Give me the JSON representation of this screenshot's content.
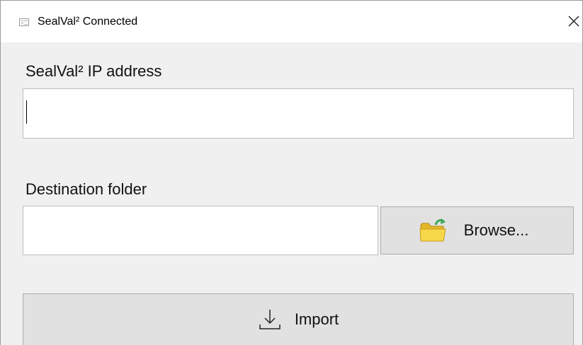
{
  "window": {
    "title": "SealVal² Connected",
    "icon": "app-window-icon",
    "close_icon": "close-icon"
  },
  "ip_field": {
    "label": "SealVal² IP address",
    "value": "",
    "placeholder": ""
  },
  "destination_field": {
    "label": "Destination folder",
    "value": "",
    "placeholder": ""
  },
  "browse_button": {
    "label": "Browse...",
    "icon": "folder-icon"
  },
  "import_button": {
    "label": "Import",
    "icon": "download-icon"
  },
  "colors": {
    "window_background": "#f0f0f0",
    "button_face": "#e1e1e1",
    "button_border": "#adadad",
    "folder_yellow": "#f6d84a",
    "folder_arrow_green": "#3aa655"
  }
}
